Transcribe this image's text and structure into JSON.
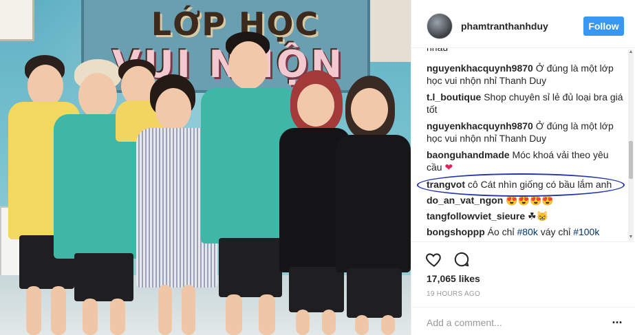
{
  "photo": {
    "sign_line1": "LỚP HỌC",
    "sign_line2": "VUI NHỘN"
  },
  "post": {
    "username": "phamtranthanhduy",
    "follow_label": "Follow"
  },
  "comments": {
    "cut_text": "nhau",
    "items": [
      {
        "author": "nguyenkhacquynh9870",
        "text": "Ở đúng là một lớp học vui nhộn nhỉ Thanh Duy"
      },
      {
        "author": "t.l_boutique",
        "text": "Shop chuyên sỉ lẻ đủ loại bra giá tốt"
      },
      {
        "author": "nguyenkhacquynh9870",
        "text": "Ở đúng là một lớp học vui nhộn nhỉ Thanh Duy"
      },
      {
        "author": "baonguhandmade",
        "text": "Móc khoá vải theo yêu cầu",
        "emoji": "❤"
      },
      {
        "author": "trangvot",
        "text": "cô Cát nhìn giống có bầu lắm anh"
      },
      {
        "author": "do_an_vat_ngon",
        "text": "😍😍😍😍"
      },
      {
        "author": "tangfollowviet_sieure",
        "text": "☘😸"
      },
      {
        "author": "bongshoppp",
        "text": "Áo chỉ",
        "tag1": "#80k",
        "text2": "váy chỉ",
        "tag2": "#100k"
      }
    ]
  },
  "actions": {
    "like_icon": "heart-outline-icon",
    "comment_icon": "speech-bubble-icon"
  },
  "likes": "17,065 likes",
  "time": "19 HOURS AGO",
  "add_comment": {
    "placeholder": "Add a comment...",
    "more_label": "..."
  },
  "colors": {
    "follow_button": "#3897f0",
    "highlight_oval": "#2233a6",
    "heart": "#e0245e"
  }
}
